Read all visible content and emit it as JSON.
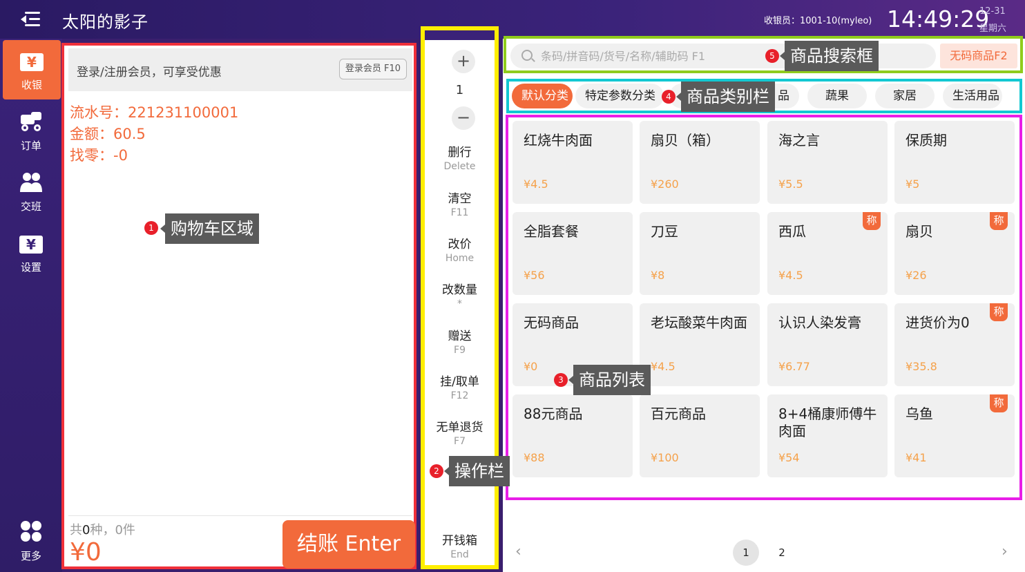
{
  "header": {
    "title": "太阳的影子",
    "cashier": "收银员：1001-10(myleo)",
    "time": "14:49:29",
    "date": "12-31",
    "weekday": "星期六"
  },
  "sidebar": {
    "items": [
      {
        "label": "收银",
        "icon": "cashier-icon",
        "active": true
      },
      {
        "label": "订单",
        "icon": "order-icon"
      },
      {
        "label": "交班",
        "icon": "shift-icon"
      },
      {
        "label": "设置",
        "icon": "settings-icon"
      },
      {
        "label": "更多",
        "icon": "more-icon"
      }
    ]
  },
  "cart": {
    "member_prompt": "登录/注册会员，可享受优惠",
    "member_button": "登录会员 F10",
    "serial": "流水号：221231100001",
    "amount": "金额：60.5",
    "change": "找零：-0",
    "count_prefix": "共",
    "count_kinds": "0",
    "count_suffix": "种，0件",
    "total": "¥0",
    "checkout": "结账 Enter"
  },
  "ops": {
    "plus": "+",
    "minus": "−",
    "quantity": "1",
    "items": [
      {
        "label": "删行",
        "key": "Delete"
      },
      {
        "label": "清空",
        "key": "F11"
      },
      {
        "label": "改价",
        "key": "Home"
      },
      {
        "label": "改数量",
        "key": "*"
      },
      {
        "label": "赠送",
        "key": "F9"
      },
      {
        "label": "挂/取单",
        "key": "F12"
      },
      {
        "label": "无单退货",
        "key": "F7"
      },
      {
        "label": "开钱箱",
        "key": "End"
      }
    ]
  },
  "search": {
    "placeholder": "条码/拼音码/货号/名称/辅助码 F1",
    "nocode_button": "无码商品F2"
  },
  "categories": [
    "默认分类",
    "特定参数分类",
    "品",
    "蔬果",
    "家居",
    "生活用品"
  ],
  "products": [
    {
      "name": "红烧牛肉面",
      "price": "¥4.5",
      "weigh": false
    },
    {
      "name": "扇贝（箱）",
      "price": "¥260",
      "weigh": false
    },
    {
      "name": "海之言",
      "price": "¥5.5",
      "weigh": false
    },
    {
      "name": "保质期",
      "price": "¥5",
      "weigh": false
    },
    {
      "name": "全脂套餐",
      "price": "¥56",
      "weigh": false
    },
    {
      "name": "刀豆",
      "price": "¥8",
      "weigh": false
    },
    {
      "name": "西瓜",
      "price": "¥4.5",
      "weigh": true
    },
    {
      "name": "扇贝",
      "price": "¥26",
      "weigh": true
    },
    {
      "name": "无码商品",
      "price": "¥0",
      "weigh": false
    },
    {
      "name": "老坛酸菜牛肉面",
      "price": "¥4.5",
      "weigh": false
    },
    {
      "name": "认识人染发膏",
      "price": "¥6.77",
      "weigh": false
    },
    {
      "name": "进货价为0",
      "price": "¥35.8",
      "weigh": true
    },
    {
      "name": "88元商品",
      "price": "¥88",
      "weigh": false
    },
    {
      "name": "百元商品",
      "price": "¥100",
      "weigh": false
    },
    {
      "name": "8+4桶康师傅牛肉面",
      "price": "¥54",
      "weigh": false
    },
    {
      "name": "乌鱼",
      "price": "¥41",
      "weigh": true
    }
  ],
  "weigh_badge": "称",
  "pager": {
    "prev": "‹",
    "next": "›",
    "pages": [
      "1",
      "2"
    ],
    "current": "1"
  },
  "annotations": [
    {
      "num": "1",
      "label": "购物车区域"
    },
    {
      "num": "2",
      "label": "操作栏"
    },
    {
      "num": "3",
      "label": "商品列表"
    },
    {
      "num": "4",
      "label": "商品类别栏"
    },
    {
      "num": "5",
      "label": "商品搜索框"
    }
  ],
  "colors": {
    "accent": "#f26a3b",
    "header_bg": "#2a1a63",
    "cart_border": "#f0303a",
    "ops_border": "#ffee00",
    "search_border": "#8fcc1c",
    "category_border": "#12c8d2",
    "grid_border": "#e81ee8",
    "price": "#f5a14a"
  }
}
